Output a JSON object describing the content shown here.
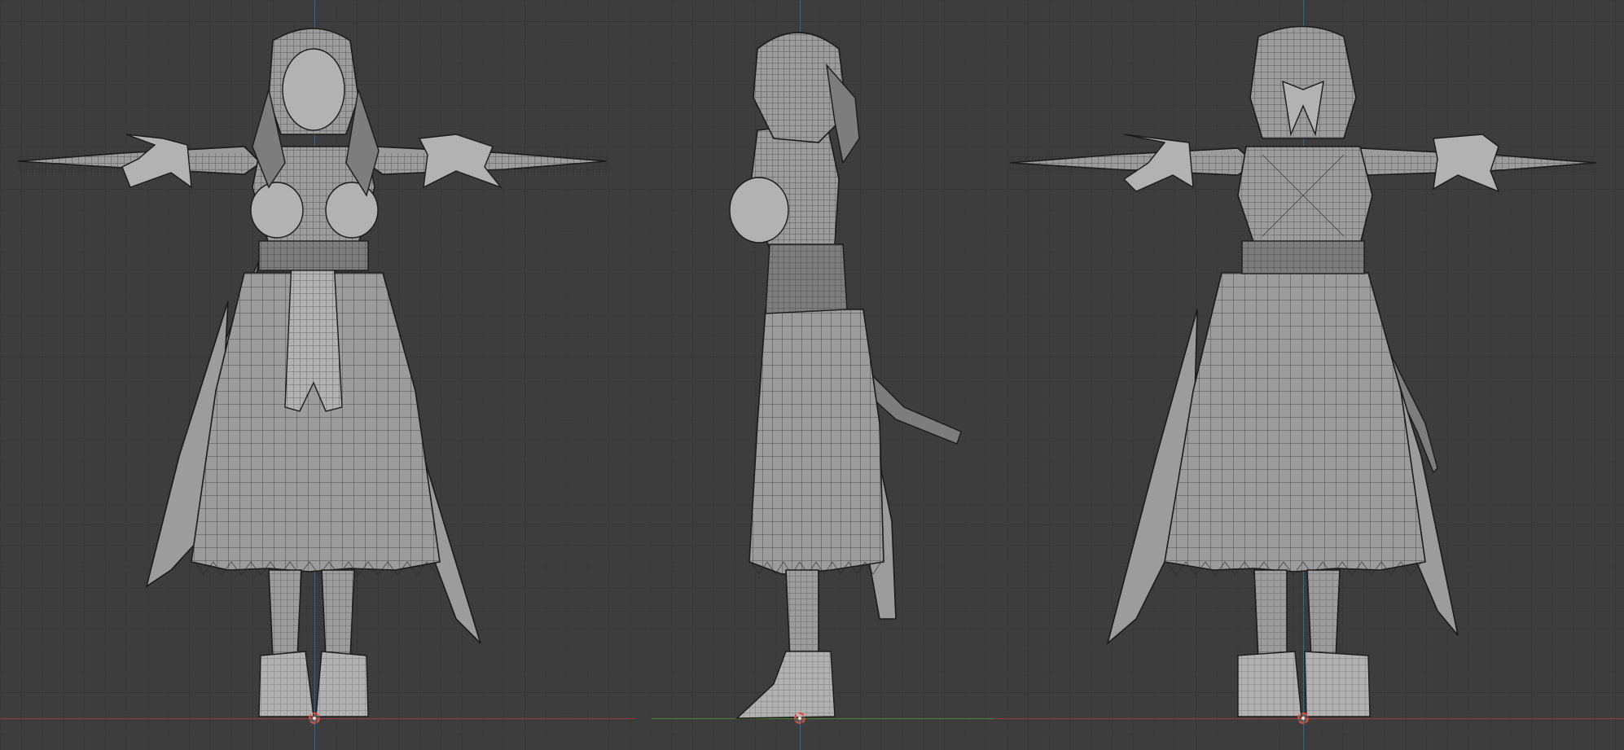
{
  "viewport": {
    "mode": "wireframe-overlay",
    "background": "#3d3d3d",
    "grid": true,
    "axis_colors": {
      "x": "#a63a3a",
      "y": "#2e6fa8",
      "z": "#4b8a2e"
    },
    "views": [
      {
        "id": "front",
        "icon": "origin-marker-icon"
      },
      {
        "id": "side",
        "icon": "origin-marker-icon"
      },
      {
        "id": "back",
        "icon": "origin-marker-icon"
      }
    ]
  }
}
